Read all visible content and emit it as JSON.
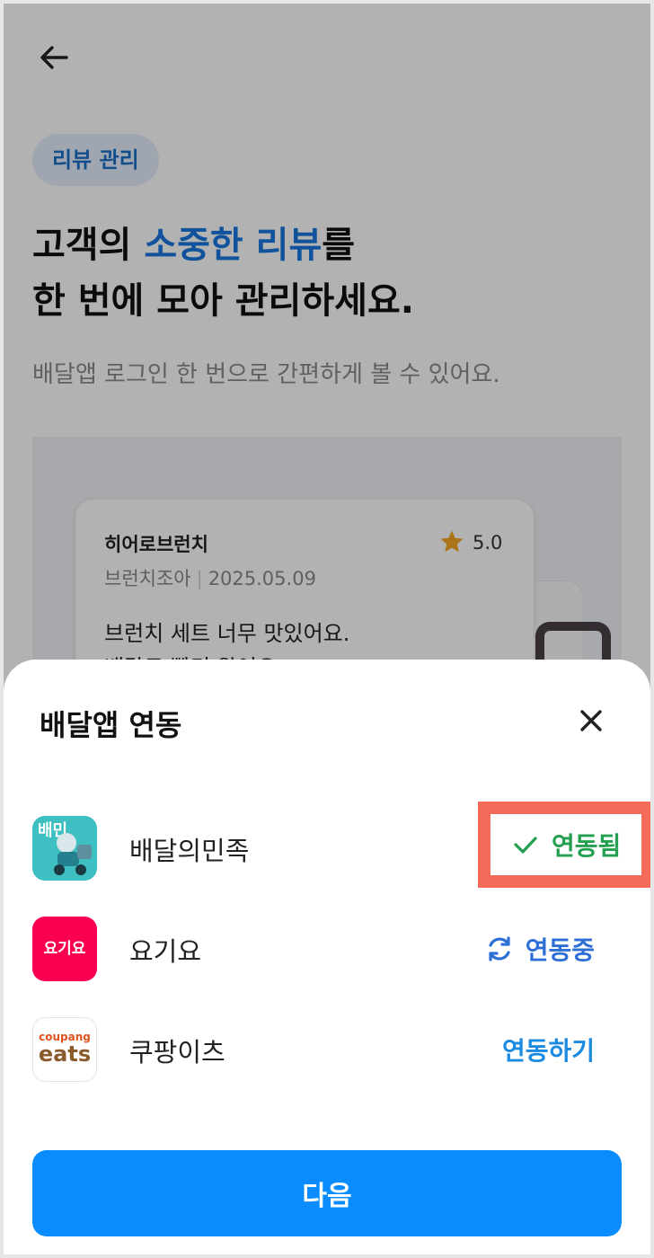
{
  "page": {
    "chip_label": "리뷰 관리",
    "headline": {
      "prefix": "고객의 ",
      "accent": "소중한 리뷰",
      "suffix": "를",
      "line2": "한 번에 모아 관리하세요."
    },
    "subtitle": "배달앱 로그인 한 번으로 간편하게 볼 수 있어요.",
    "review_preview": {
      "store_name": "히어로브런치",
      "rating": "5.0",
      "menu": "브런치조아",
      "date": "2025.05.09",
      "text": "브런치 세트 너무 맛있어요.",
      "text_line2": "배달도 빨리 왔어요"
    }
  },
  "sheet": {
    "title": "배달앱 연동",
    "apps": [
      {
        "name": "배달의민족",
        "icon": "baemin-icon",
        "icon_text": "배민",
        "status": "연동됨",
        "status_icon": "check-icon",
        "status_color": "#22a04f"
      },
      {
        "name": "요기요",
        "icon": "yogiyo-icon",
        "icon_text": "요기요",
        "status": "연동중",
        "status_icon": "refresh-icon",
        "status_color": "#2d6fd6"
      },
      {
        "name": "쿠팡이츠",
        "icon": "coupang-eats-icon",
        "icon_text_small": "coupang",
        "icon_text_big": "eats",
        "status": "연동하기",
        "status_color": "#1a8be0"
      }
    ],
    "next_label": "다음"
  },
  "colors": {
    "accent": "#1778e0",
    "primary_button": "#0a8cff",
    "highlight_box": "#f26b5b"
  }
}
